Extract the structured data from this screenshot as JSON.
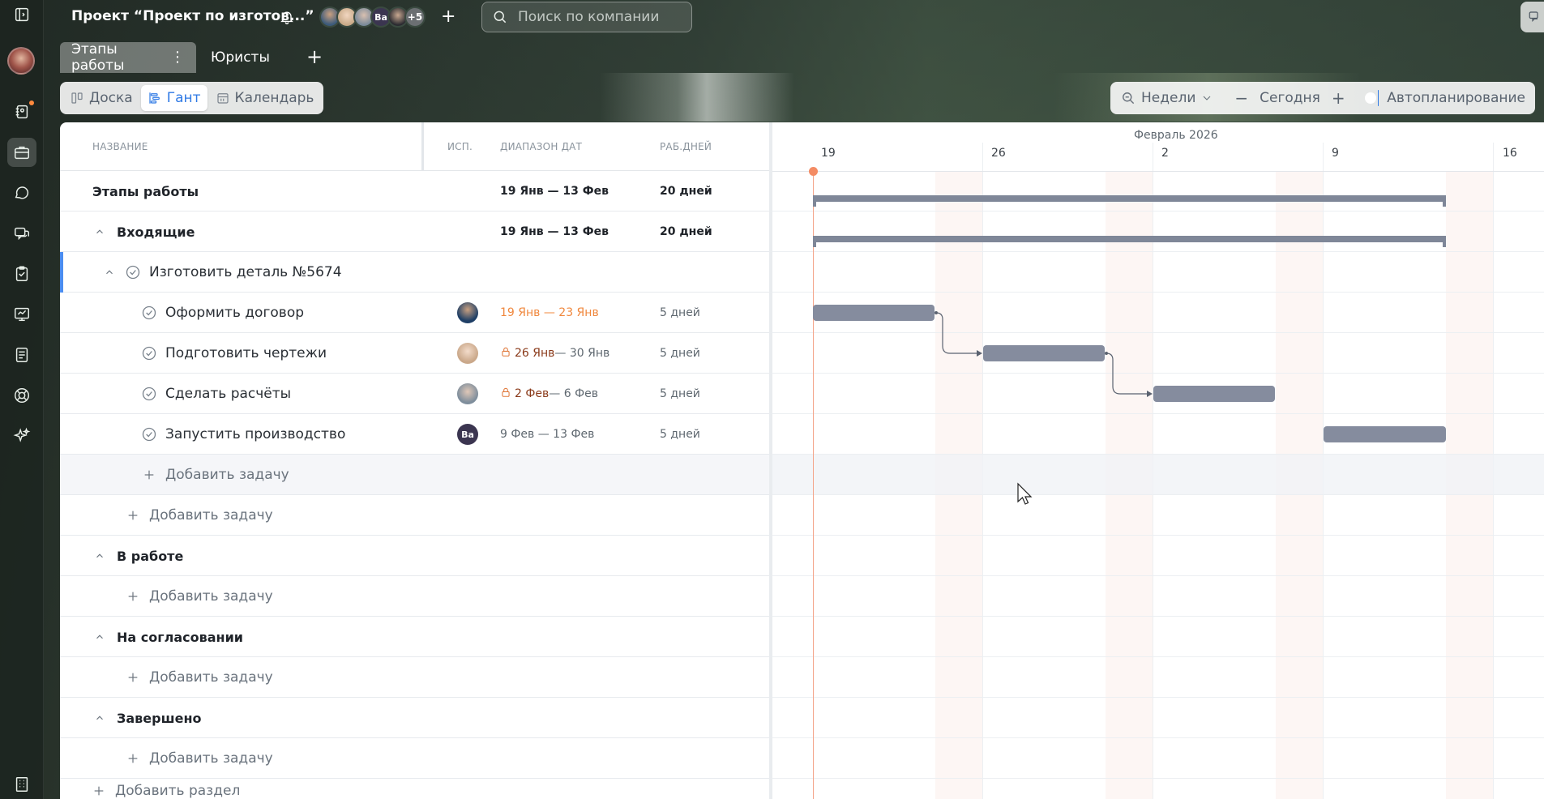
{
  "header": {
    "project_title": "Проект “Проект по изготов...”",
    "avatars": [
      {
        "kind": "photo"
      },
      {
        "kind": "photo"
      },
      {
        "kind": "photo"
      },
      {
        "kind": "initials",
        "text": "Ba"
      },
      {
        "kind": "photo"
      },
      {
        "kind": "more",
        "text": "+5"
      }
    ],
    "add_member_label": "+",
    "search_placeholder": "Поиск по компании"
  },
  "tabs": [
    {
      "label": "Этапы работы",
      "active": true,
      "menu": "⋮"
    },
    {
      "label": "Юристы",
      "active": false
    }
  ],
  "tab_add_label": "+",
  "views": [
    {
      "label": "Доска",
      "icon": "board-icon",
      "active": false
    },
    {
      "label": "Гант",
      "icon": "gantt-icon",
      "active": true
    },
    {
      "label": "Календарь",
      "icon": "calendar-icon",
      "active": false
    }
  ],
  "toolbar": {
    "scale_label": "Недели",
    "zoom_out": "−",
    "today_label": "Сегодня",
    "zoom_in": "+",
    "autoplan_label": "Автопланирование",
    "autoplan_on": true
  },
  "table": {
    "columns": {
      "name": "НАЗВАНИЕ",
      "assignee": "ИСП.",
      "date_range": "ДИАПАЗОН ДАТ",
      "work_days": "РАБ.ДНЕЙ"
    },
    "rows": [
      {
        "type": "project",
        "name": "Этапы работы",
        "dates": "19 Янв — 13 Фев",
        "days": "20 дней"
      },
      {
        "type": "section",
        "name": "Входящие",
        "dates": "19 Янв — 13 Фев",
        "days": "20 дней"
      },
      {
        "type": "group",
        "name": "Изготовить деталь №5674"
      },
      {
        "type": "task",
        "name": "Оформить договор",
        "dates": "19 Янв — 23 Янв",
        "days": "5 дней",
        "assignee": "photo1"
      },
      {
        "type": "task",
        "name": "Подготовить чертежи",
        "dates_start": "26 Янв",
        "dates_end": " — 30 Янв",
        "days": "5 дней",
        "assignee": "photo2",
        "locked": true
      },
      {
        "type": "task",
        "name": "Сделать расчёты",
        "dates_start": "2 Фев",
        "dates_end": " — 6 Фев",
        "days": "5 дней",
        "assignee": "photo3",
        "locked": true
      },
      {
        "type": "task",
        "name": "Запустить производство",
        "dates": "9 Фев — 13 Фев",
        "days": "5 дней",
        "assignee_initials": "Ba"
      },
      {
        "type": "add",
        "label": "Добавить задачу"
      },
      {
        "type": "add",
        "label": "Добавить задачу"
      },
      {
        "type": "section",
        "name": "В работе"
      },
      {
        "type": "add",
        "label": "Добавить задачу"
      },
      {
        "type": "section",
        "name": "На согласовании"
      },
      {
        "type": "add",
        "label": "Добавить задачу"
      },
      {
        "type": "section",
        "name": "Завершено"
      },
      {
        "type": "add",
        "label": "Добавить задачу"
      },
      {
        "type": "add-section",
        "label": "Добавить раздел"
      }
    ]
  },
  "gantt": {
    "month_label": "Февраль 2026",
    "week_labels": [
      "19",
      "26",
      "2",
      "9",
      "16"
    ]
  },
  "colors": {
    "accent": "#2f7ae5",
    "bar": "#858c9e",
    "today": "#f48c64",
    "overdue_date": "#f0883e"
  }
}
